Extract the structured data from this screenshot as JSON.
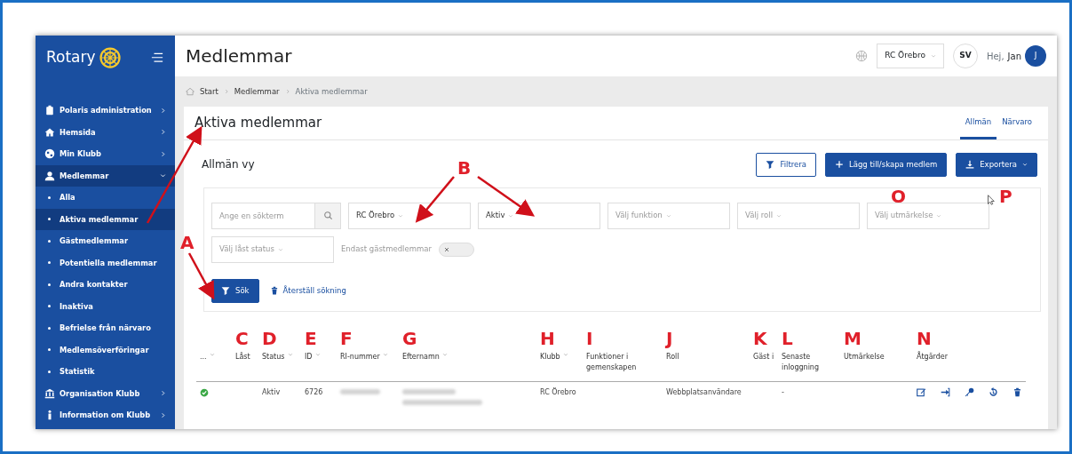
{
  "sidebar": {
    "logo": "Rotary",
    "items": [
      {
        "label": "Polaris administration",
        "selected": false,
        "expanded": false
      },
      {
        "label": "Hemsida",
        "selected": false,
        "expanded": false
      },
      {
        "label": "Min Klubb",
        "selected": false,
        "expanded": false
      },
      {
        "label": "Medlemmar",
        "selected": true,
        "expanded": true,
        "children": [
          {
            "label": "Alla",
            "selected": false
          },
          {
            "label": "Aktiva medlemmar",
            "selected": true
          },
          {
            "label": "Gästmedlemmar",
            "selected": false
          },
          {
            "label": "Potentiella medlemmar",
            "selected": false
          },
          {
            "label": "Andra kontakter",
            "selected": false
          },
          {
            "label": "Inaktiva",
            "selected": false
          },
          {
            "label": "Befrielse från närvaro",
            "selected": false
          },
          {
            "label": "Medlemsöverföringar",
            "selected": false
          },
          {
            "label": "Statistik",
            "selected": false
          }
        ]
      },
      {
        "label": "Organisation Klubb",
        "selected": false,
        "expanded": false
      },
      {
        "label": "Information om Klubb",
        "selected": false,
        "expanded": false
      }
    ]
  },
  "header": {
    "title": "Medlemmar",
    "club": "RC Örebro",
    "language": "SV",
    "greeting": "Hej,",
    "user": "Jan",
    "avatar": "J"
  },
  "breadcrumb": [
    {
      "label": "Start",
      "current": false
    },
    {
      "label": "Medlemmar",
      "current": false
    },
    {
      "label": "Aktiva medlemmar",
      "current": true
    }
  ],
  "page": {
    "title": "Aktiva medlemmar",
    "tabs": [
      {
        "label": "Allmän",
        "selected": true
      },
      {
        "label": "Närvaro",
        "selected": false
      }
    ],
    "view_title": "Allmän vy",
    "buttons": [
      {
        "label": "Filtrera",
        "kind": "outline"
      },
      {
        "label": "Lägg till/skapa medlem",
        "kind": "add"
      },
      {
        "label": "Exportera",
        "kind": "export"
      }
    ]
  },
  "filters": {
    "search": {
      "placeholder": "Ange en sökterm"
    },
    "selects": [
      {
        "value": "RC Örebro"
      },
      {
        "value": "Aktiv"
      },
      {
        "placeholder": "Välj funktion"
      },
      {
        "placeholder": "Välj roll"
      },
      {
        "placeholder": "Välj utmärkelse"
      },
      {
        "placeholder": "Välj låst status"
      }
    ],
    "toggle": {
      "label": "Endast gästmedlemmar",
      "on": false
    },
    "search_button": "Sök",
    "reset_button": "Återställ sökning"
  },
  "table": {
    "columns": [
      {
        "label": "...",
        "sortable": true
      },
      {
        "label": "Låst",
        "marker": "C",
        "sortable": false
      },
      {
        "label": "Status",
        "marker": "D",
        "sortable": true
      },
      {
        "label": "ID",
        "marker": "E",
        "sortable": true
      },
      {
        "label": "RI-nummer",
        "marker": "F",
        "sortable": true
      },
      {
        "label": "Efternamn",
        "marker": "G",
        "sortable": true
      },
      {
        "label": "Klubb",
        "marker": "H",
        "sortable": true
      },
      {
        "label": "Funktioner i gemenskapen",
        "marker": "I",
        "sortable": false
      },
      {
        "label": "Roll",
        "marker": "J",
        "sortable": false
      },
      {
        "label": "Gäst i",
        "marker": "K",
        "sortable": false
      },
      {
        "label": "Senaste inloggning",
        "marker": "L",
        "sortable": false
      },
      {
        "label": "Utmärkelse",
        "marker": "M",
        "sortable": false
      },
      {
        "label": "Åtgärder",
        "marker": "N",
        "sortable": false
      }
    ],
    "rows": [
      {
        "ok": true,
        "status": "Aktiv",
        "id": "6726",
        "club": "RC Örebro",
        "role": "Webbplatsanvändare",
        "last_login": "-"
      }
    ]
  },
  "annotations": [
    {
      "label": "A"
    },
    {
      "label": "B"
    },
    {
      "label": "O"
    },
    {
      "label": "P"
    }
  ]
}
